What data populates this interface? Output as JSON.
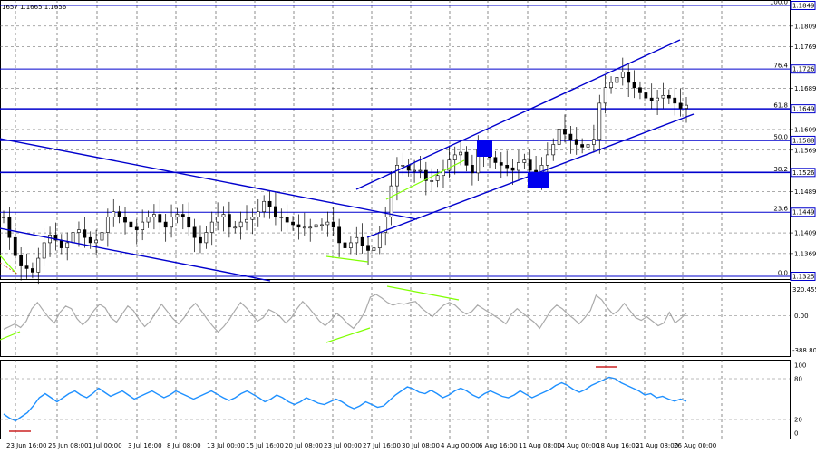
{
  "chart_data": [
    {
      "type": "candlestick",
      "header": "1657 1.1665 1.1656",
      "price_axis": {
        "min": 1.1325,
        "max": 1.1849,
        "ticks": [
          "1.1809",
          "1.1769",
          "1.1689",
          "1.1609",
          "1.1569",
          "1.1489",
          "1.1409",
          "1.1369"
        ]
      },
      "fib_levels": [
        {
          "label": "100.0",
          "price": 1.1849,
          "tag": "1.1849"
        },
        {
          "label": "76.4",
          "price": 1.1726,
          "tag": "1.1726"
        },
        {
          "label": "61.8",
          "price": 1.1649,
          "tag": "1.1649"
        },
        {
          "label": "50.0",
          "price": 1.1588,
          "tag": "1.1588"
        },
        {
          "label": "38.2",
          "price": 1.1526,
          "tag": "1.1526"
        },
        {
          "label": "23.6",
          "price": 1.1449,
          "tag": "1.1449"
        },
        {
          "label": "0.0",
          "price": 1.1325,
          "tag": "1.1325"
        }
      ],
      "close_series": [
        1.144,
        1.14,
        1.1365,
        1.1345,
        1.134,
        1.1333,
        1.136,
        1.139,
        1.1405,
        1.1395,
        1.138,
        1.139,
        1.141,
        1.1415,
        1.14,
        1.139,
        1.1395,
        1.141,
        1.144,
        1.145,
        1.144,
        1.143,
        1.142,
        1.1415,
        1.143,
        1.144,
        1.1445,
        1.143,
        1.142,
        1.144,
        1.1445,
        1.144,
        1.142,
        1.14,
        1.139,
        1.141,
        1.143,
        1.144,
        1.1445,
        1.142,
        1.142,
        1.143,
        1.1435,
        1.144,
        1.145,
        1.147,
        1.146,
        1.144,
        1.144,
        1.143,
        1.1425,
        1.142,
        1.142,
        1.142,
        1.1425,
        1.1425,
        1.143,
        1.142,
        1.139,
        1.138,
        1.139,
        1.14,
        1.1385,
        1.1375,
        1.138,
        1.141,
        1.144,
        1.15,
        1.154,
        1.154,
        1.153,
        1.153,
        1.153,
        1.151,
        1.151,
        1.152,
        1.153,
        1.155,
        1.156,
        1.1565,
        1.154,
        1.1525,
        1.157,
        1.1565,
        1.1555,
        1.1545,
        1.154,
        1.1535,
        1.153,
        1.1545,
        1.155,
        1.153,
        1.152,
        1.154,
        1.156,
        1.158,
        1.161,
        1.16,
        1.159,
        1.158,
        1.1575,
        1.158,
        1.159,
        1.166,
        1.169,
        1.17,
        1.171,
        1.172,
        1.17,
        1.169,
        1.168,
        1.167,
        1.1665,
        1.167,
        1.1675,
        1.167,
        1.166,
        1.165,
        1.1656
      ],
      "x_labels": [
        "23 Jun 16:00",
        "26 Jun 08:00",
        "1 Jul 00:00",
        "3 Jul 16:00",
        "8 Jul 08:00",
        "13 Jul 00:00",
        "15 Jul 16:00",
        "20 Jul 08:00",
        "23 Jul 00:00",
        "27 Jul 16:00",
        "30 Jul 08:00",
        "4 Aug 00:00",
        "6 Aug 16:00",
        "11 Aug 08:00",
        "14 Aug 00:00",
        "18 Aug 16:00",
        "21 Aug 08:00",
        "26 Aug 00:00"
      ]
    },
    {
      "type": "line",
      "indicator": "oscillator",
      "axis_max_label": "320.4558",
      "axis_mid_label": "0.00",
      "axis_min_label": "-388.803",
      "ylim": [
        -388.803,
        320.4558
      ],
      "color": "#aaaaaa",
      "values": [
        -150,
        -120,
        -90,
        -130,
        -60,
        80,
        150,
        60,
        -20,
        -80,
        40,
        110,
        80,
        -30,
        -100,
        -40,
        60,
        130,
        90,
        -20,
        -70,
        20,
        110,
        60,
        -40,
        -120,
        -60,
        40,
        130,
        50,
        -30,
        -90,
        -20,
        80,
        140,
        60,
        -30,
        -110,
        -180,
        -120,
        -40,
        60,
        150,
        90,
        20,
        -60,
        -20,
        70,
        40,
        -10,
        -80,
        -20,
        80,
        160,
        100,
        20,
        -60,
        -110,
        -50,
        30,
        -20,
        -90,
        -140,
        -60,
        40,
        210,
        240,
        200,
        150,
        120,
        140,
        130,
        150,
        160,
        90,
        40,
        -10,
        60,
        120,
        150,
        120,
        60,
        20,
        50,
        120,
        80,
        40,
        0,
        -40,
        -90,
        20,
        80,
        30,
        -20,
        -70,
        -140,
        -40,
        60,
        120,
        80,
        20,
        -30,
        -90,
        -20,
        60,
        230,
        180,
        90,
        20,
        60,
        140,
        60,
        -20,
        -50,
        -10,
        -60,
        -110,
        -80,
        40,
        -80,
        -30,
        30
      ]
    },
    {
      "type": "line",
      "indicator": "oscillator",
      "axis_labels": [
        "100",
        "80",
        "20",
        "0"
      ],
      "ylim": [
        0,
        100
      ],
      "color": "#1e90ff",
      "values": [
        28,
        22,
        18,
        24,
        30,
        40,
        52,
        58,
        52,
        46,
        52,
        58,
        62,
        56,
        52,
        58,
        66,
        60,
        54,
        58,
        62,
        56,
        50,
        54,
        58,
        62,
        57,
        52,
        56,
        62,
        58,
        54,
        50,
        54,
        58,
        62,
        57,
        52,
        48,
        52,
        58,
        62,
        57,
        52,
        46,
        50,
        56,
        52,
        46,
        42,
        46,
        52,
        48,
        44,
        42,
        46,
        50,
        46,
        40,
        36,
        40,
        46,
        42,
        38,
        40,
        48,
        56,
        62,
        68,
        65,
        60,
        58,
        63,
        58,
        52,
        56,
        62,
        66,
        62,
        56,
        52,
        58,
        62,
        58,
        54,
        52,
        56,
        62,
        57,
        52,
        56,
        60,
        64,
        70,
        74,
        70,
        64,
        60,
        64,
        70,
        74,
        78,
        82,
        80,
        74,
        70,
        66,
        62,
        56,
        58,
        52,
        54,
        50,
        47,
        50,
        47
      ]
    }
  ]
}
